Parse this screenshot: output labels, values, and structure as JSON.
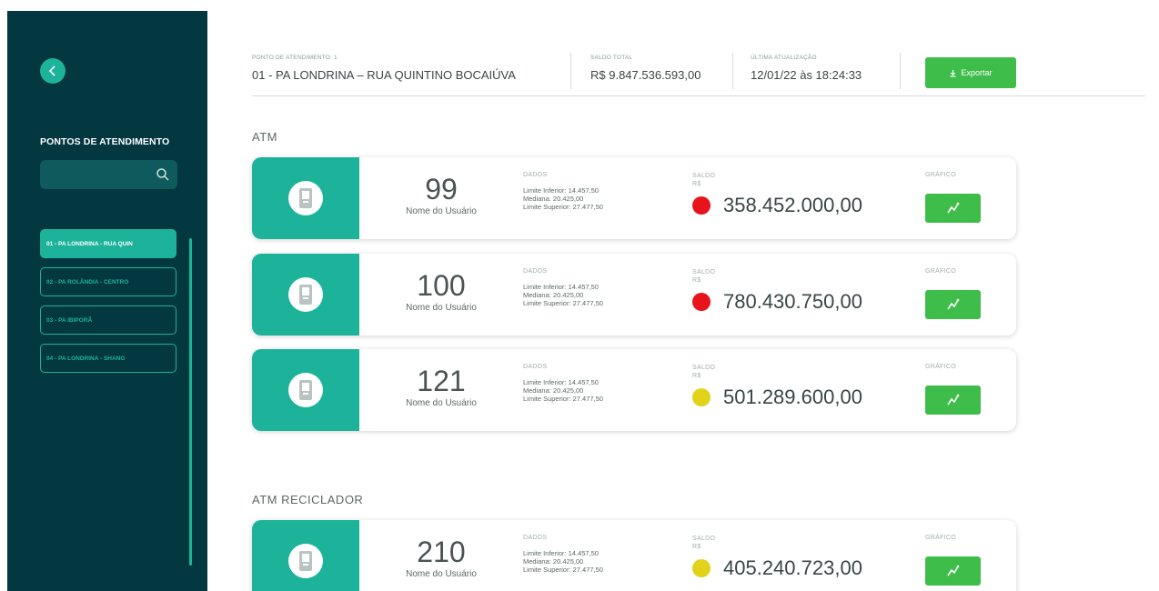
{
  "colors": {
    "sidebar_bg": "#033840",
    "accent": "#1db39a",
    "button_green": "#3fbd4b",
    "status_red": "#e8141b",
    "status_yellow": "#e0d31a"
  },
  "sidebar": {
    "back_icon": "chevron-left-icon",
    "title": "PONTOS DE ATENDIMENTO",
    "search": {
      "value": "",
      "placeholder": "",
      "icon": "search-icon"
    },
    "items": [
      {
        "label": "01 - PA LONDRINA - RUA QUIN",
        "active": true
      },
      {
        "label": "02 - PA ROLÂNDIA - CENTRO",
        "active": false
      },
      {
        "label": "03 - PA IBIPORÃ",
        "active": false
      },
      {
        "label": "04 - PA LONDRINA - SHANG",
        "active": false
      }
    ]
  },
  "header": {
    "ponto_label": "PONTO DE ATENDIMENTO: 1",
    "ponto_value": "01 - PA LONDRINA – RUA QUINTINO BOCAIÚVA",
    "saldo_label": "SALDO TOTAL",
    "saldo_value": "R$ 9.847.536.593,00",
    "atualizacao_label": "ÚLTIMA ATUALIZAÇÃO",
    "atualizacao_value": "12/01/22 às 18:24:33",
    "export_label": "Exportar",
    "export_icon": "download-icon"
  },
  "sections": [
    {
      "title": "ATM",
      "cards": [
        {
          "number": "99",
          "user": "Nome do Usuário",
          "dados_label": "DADOS",
          "limite_inferior": "Limite Inferior: 14.457,50",
          "mediana": "Mediana: 20.425,00",
          "limite_superior": "Limite Superior: 27.477,50",
          "saldo_label": "SALDO",
          "saldo_currency": "R$",
          "status": "red",
          "saldo_value": "358.452.000,00",
          "grafico_label": "GRÁFICO"
        },
        {
          "number": "100",
          "user": "Nome do Usuário",
          "dados_label": "DADOS",
          "limite_inferior": "Limite Inferior: 14.457,50",
          "mediana": "Mediana: 20.425,00",
          "limite_superior": "Limite Superior: 27.477,50",
          "saldo_label": "SALDO",
          "saldo_currency": "R$",
          "status": "red",
          "saldo_value": "780.430.750,00",
          "grafico_label": "GRÁFICO"
        },
        {
          "number": "121",
          "user": "Nome do Usuário",
          "dados_label": "DADOS",
          "limite_inferior": "Limite Inferior: 14.457,50",
          "mediana": "Mediana: 20.425,00",
          "limite_superior": "Limite Superior: 27.477,50",
          "saldo_label": "SALDO",
          "saldo_currency": "R$",
          "status": "yellow",
          "saldo_value": "501.289.600,00",
          "grafico_label": "GRÁFICO"
        }
      ]
    },
    {
      "title": "ATM RECICLADOR",
      "cards": [
        {
          "number": "210",
          "user": "Nome do Usuário",
          "dados_label": "DADOS",
          "limite_inferior": "Limite Inferior: 14.457,50",
          "mediana": "Mediana: 20.425,00",
          "limite_superior": "Limite Superior: 27.477,50",
          "saldo_label": "SALDO",
          "saldo_currency": "R$",
          "status": "yellow",
          "saldo_value": "405.240.723,00",
          "grafico_label": "GRÁFICO"
        }
      ]
    }
  ]
}
